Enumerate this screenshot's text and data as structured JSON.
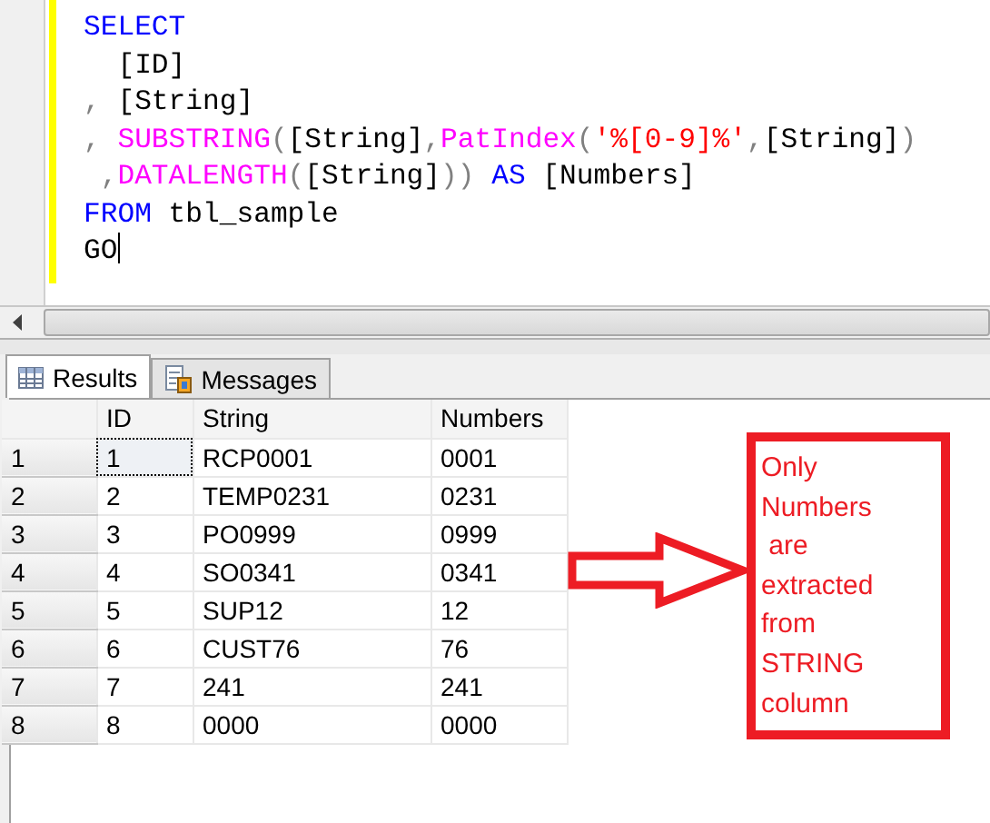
{
  "editor": {
    "lines": [
      [
        {
          "kind": "keyword",
          "text": "SELECT"
        }
      ],
      [
        {
          "kind": "plain",
          "text": "  [ID]"
        }
      ],
      [
        {
          "kind": "operator",
          "text": ","
        },
        {
          "kind": "plain",
          "text": " [String]"
        }
      ],
      [
        {
          "kind": "operator",
          "text": ", "
        },
        {
          "kind": "function",
          "text": "SUBSTRING"
        },
        {
          "kind": "operator",
          "text": "("
        },
        {
          "kind": "plain",
          "text": "[String]"
        },
        {
          "kind": "operator",
          "text": ","
        },
        {
          "kind": "function",
          "text": "PatIndex"
        },
        {
          "kind": "operator",
          "text": "("
        },
        {
          "kind": "string",
          "text": "'%[0-9]%'"
        },
        {
          "kind": "operator",
          "text": ","
        },
        {
          "kind": "plain",
          "text": "[String]"
        },
        {
          "kind": "operator",
          "text": ")"
        }
      ],
      [
        {
          "kind": "operator",
          "text": " ,"
        },
        {
          "kind": "function",
          "text": "DATALENGTH"
        },
        {
          "kind": "operator",
          "text": "("
        },
        {
          "kind": "plain",
          "text": "[String]"
        },
        {
          "kind": "operator",
          "text": ")) "
        },
        {
          "kind": "keyword",
          "text": "AS"
        },
        {
          "kind": "plain",
          "text": " [Numbers]"
        }
      ],
      [
        {
          "kind": "keyword",
          "text": "FROM"
        },
        {
          "kind": "plain",
          "text": " tbl_sample"
        }
      ],
      [
        {
          "kind": "plain",
          "text": "GO"
        }
      ]
    ]
  },
  "tabs": [
    {
      "label": "Results",
      "selected": true
    },
    {
      "label": "Messages",
      "selected": false
    }
  ],
  "grid": {
    "columns": [
      "ID",
      "String",
      "Numbers"
    ],
    "rows": [
      {
        "number": "1",
        "cells": [
          "1",
          "RCP0001",
          "0001"
        ],
        "selected": true
      },
      {
        "number": "2",
        "cells": [
          "2",
          "TEMP0231",
          "0231"
        ],
        "selected": false
      },
      {
        "number": "3",
        "cells": [
          "3",
          "PO0999",
          "0999"
        ],
        "selected": false
      },
      {
        "number": "4",
        "cells": [
          "4",
          "SO0341",
          "0341"
        ],
        "selected": false
      },
      {
        "number": "5",
        "cells": [
          "5",
          "SUP12",
          "12"
        ],
        "selected": false
      },
      {
        "number": "6",
        "cells": [
          "6",
          "CUST76",
          "76"
        ],
        "selected": false
      },
      {
        "number": "7",
        "cells": [
          "7",
          "241",
          "241"
        ],
        "selected": false
      },
      {
        "number": "8",
        "cells": [
          "8",
          "0000",
          "0000"
        ],
        "selected": false
      }
    ]
  },
  "annotation": {
    "lines": [
      "Only",
      "Numbers",
      " are",
      "extracted",
      "from",
      "STRING",
      "column"
    ]
  }
}
